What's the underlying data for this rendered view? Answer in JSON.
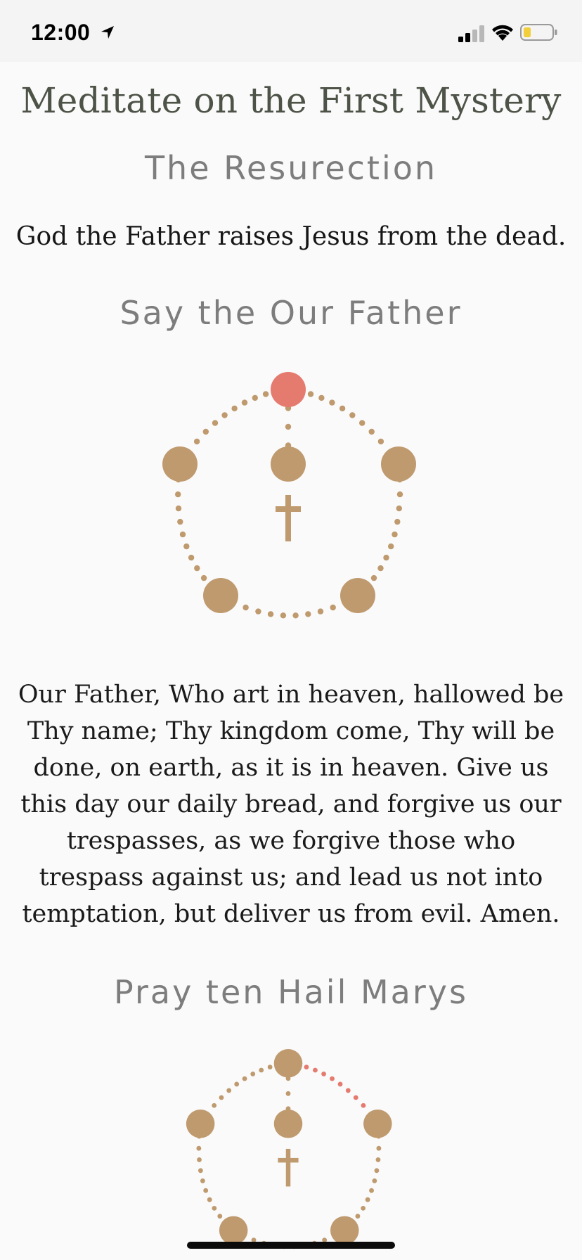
{
  "status_bar": {
    "time": "12:00"
  },
  "mystery": {
    "title": "Meditate on the First Mystery",
    "name": "The Resurection",
    "description": "God the Father raises Jesus from the dead."
  },
  "steps": [
    {
      "heading": "Say the Our Father",
      "prayer": "Our Father, Who art in heaven, hallowed be Thy name; Thy kingdom come, Thy will be done, on earth, as it is in heaven. Give us this day our daily bread, and forgive us our trespasses, as we forgive those who trespass against us; and lead us not into temptation, but deliver us from evil. Amen.",
      "highlight": "top-bead"
    },
    {
      "heading": "Pray ten Hail Marys",
      "highlight": "top-right-decade"
    }
  ],
  "colors": {
    "bead": "#bf9a6e",
    "highlight": "#e57a6f",
    "heading": "#7d7d7d",
    "title": "#4d5347",
    "background": "#fafafa"
  },
  "icons": [
    "location-arrow-icon",
    "cellular-signal-icon",
    "wifi-icon",
    "battery-icon",
    "cross-icon"
  ]
}
